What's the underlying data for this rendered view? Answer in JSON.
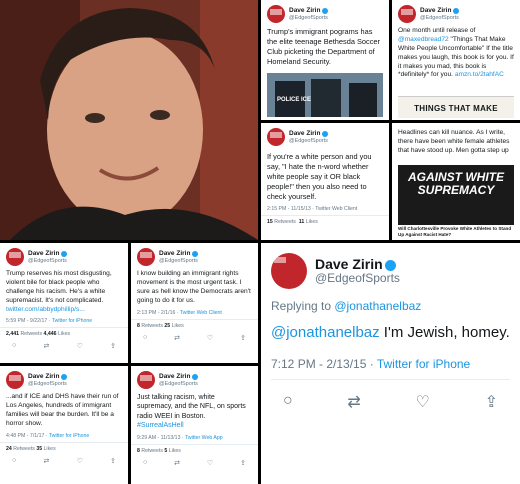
{
  "author": {
    "name": "Dave Zirin",
    "handle": "@EdgeofSports"
  },
  "tweets": {
    "t1": {
      "text": "Trump's immigrant pograms has the elite teenage  Bethesda Soccer Club picketing the Department of Homeland Security.",
      "img_caption": "POLICE ICE"
    },
    "t2": {
      "text_a": "One month until release of ",
      "mention": "@maxedbread72",
      "text_b": " \"Things That Make White People Uncomfortable\" If the title makes you laugh, this book is for you. If it makes you mad, this book is *definitely* for you. ",
      "link": "amzn.to/2tahfAC",
      "img_caption": "THINGS THAT MAKE"
    },
    "t3": {
      "text": "If you're a white person and you say, \"I hate the n-word whether white people say it OR black people!\" then you also need to check yourself.",
      "meta": "2:15 PM - 11/15/13 · Twitter Web Client",
      "retweets": "15",
      "likes": "11",
      "retweets_label": "Retweets",
      "likes_label": "Likes"
    },
    "t4": {
      "text": "Headlines can kill nuance. As I write, there have been white female athletes that have stood up. Men gotta step up",
      "img_text": "AGAINST WHITE SUPREMACY",
      "img_caption": "Will Charlottesville Provoke White Athletes to Stand Up Against Racist Hate?"
    },
    "t5": {
      "text": "Trump reserves his most disgusting, violent bile for black people who challenge his racism. He's a white supremacist. It's not complicated.",
      "link": "twitter.com/abbydphillip/s...",
      "meta": "5:59 PM - 9/22/17 · ",
      "meta_src": "Twitter for iPhone",
      "retweets": "2,441",
      "likes": "4,446",
      "retweets_label": "Retweets",
      "likes_label": "Likes"
    },
    "t6": {
      "text": "I know building an immigrant rights movement is the most urgent task. I sure as hell know the Democrats aren't going to do it for us.",
      "meta": "2:13 PM - 2/1/16 · ",
      "meta_src": "Twitter Web Client",
      "retweets": "8",
      "likes": "25",
      "retweets_label": "Retweets",
      "likes_label": "Likes"
    },
    "t7": {
      "reply_label": "Replying to ",
      "reply_to": "@jonathanelbaz",
      "mention": "@jonathanelbaz",
      "text": " I'm Jewish, homey.",
      "meta": "7:12 PM - 2/13/15 · ",
      "meta_src": "Twitter for iPhone"
    },
    "t8": {
      "text": "...and if ICE and DHS have their run of Los Angeles, hundreds of immigrant families will bear the burden. It'll be a horror show.",
      "meta": "4:48 PM - 7/1/17 · ",
      "meta_src": "Twitter for iPhone",
      "retweets": "24",
      "likes": "35",
      "retweets_label": "Retweets",
      "likes_label": "Likes"
    },
    "t9": {
      "text": "Just talking racism, white supremacy, and the NFL, on sports radio WEEI in Boston. ",
      "hashtag": "#SurrealAsHell",
      "meta": "9:29 AM - 11/13/13 · ",
      "meta_src": "Twitter Web App",
      "retweets": "8",
      "likes": "5",
      "retweets_label": "Retweets",
      "likes_label": "Likes"
    }
  },
  "icons": {
    "reply": "reply-icon",
    "retweet": "retweet-icon",
    "like": "heart-icon",
    "share": "share-icon"
  },
  "colors": {
    "link": "#1b95e0",
    "accent": "#1da1f2",
    "muted": "#657786"
  }
}
